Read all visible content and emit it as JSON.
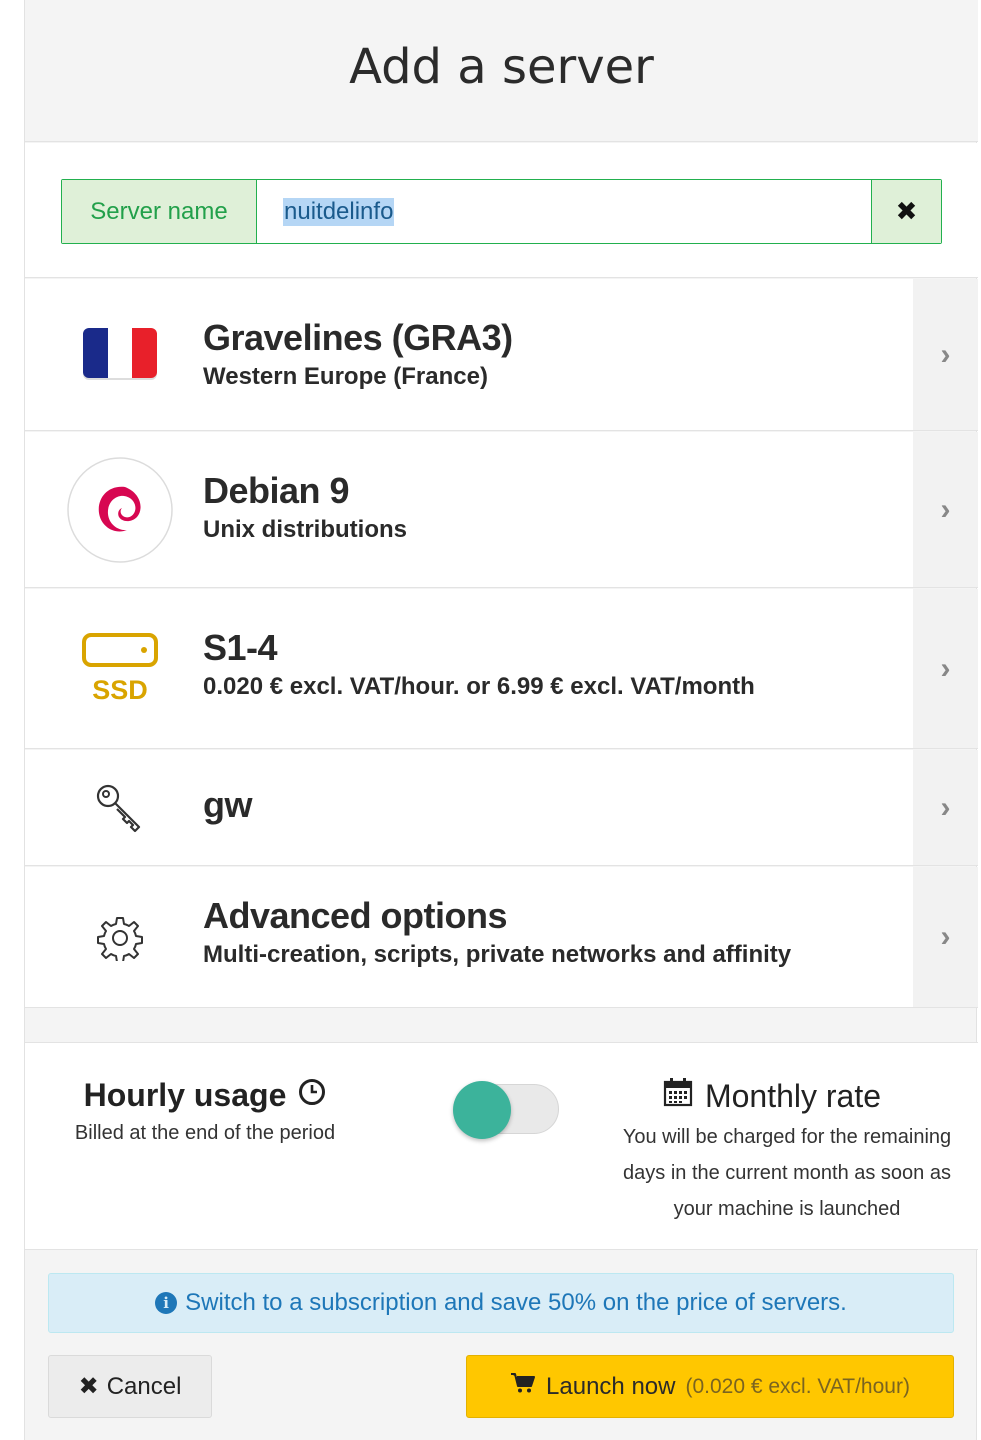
{
  "header": {
    "title": "Add a server"
  },
  "server_name": {
    "label": "Server name",
    "value": "nuitdelinfo",
    "clear_icon": "close-icon"
  },
  "rows": {
    "region": {
      "title": "Gravelines (GRA3)",
      "subtitle": "Western Europe (France)",
      "icon": "france-flag-icon"
    },
    "image": {
      "title": "Debian 9",
      "subtitle": "Unix distributions",
      "icon": "debian-logo-icon"
    },
    "flavor": {
      "title": "S1-4",
      "subtitle": "0.020 € excl. VAT/hour. or 6.99 € excl. VAT/month",
      "icon": "ssd-icon",
      "icon_label": "SSD"
    },
    "sshkey": {
      "title": "gw",
      "icon": "key-icon"
    },
    "advanced": {
      "title": "Advanced options",
      "subtitle": "Multi-creation, scripts, private networks and affinity",
      "icon": "gear-icon"
    }
  },
  "billing": {
    "hourly_title": "Hourly usage",
    "hourly_desc": "Billed at the end of the period",
    "monthly_title": "Monthly rate",
    "monthly_desc_1": "You will be charged for the remaining",
    "monthly_desc_2": "days in the current month as soon as",
    "monthly_desc_3": "your machine is launched",
    "toggle_state": "hourly"
  },
  "alert": {
    "text": "Switch to a subscription and save 50% on the price of servers."
  },
  "actions": {
    "cancel_label": "Cancel",
    "launch_label": "Launch now",
    "launch_price": "(0.020 € excl. VAT/hour)"
  },
  "colors": {
    "success_green": "#22b04e",
    "toggle_teal": "#3cb39b",
    "launch_yellow": "#ffc700",
    "info_blue": "#1e77b8",
    "ssd_gold": "#d9a400"
  }
}
